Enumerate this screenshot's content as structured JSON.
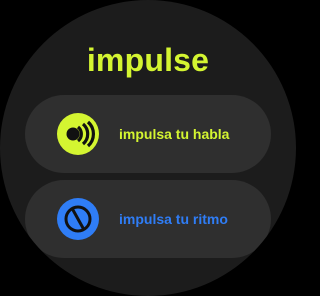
{
  "app": {
    "title": "impulse"
  },
  "colors": {
    "background": "#1c1c1c",
    "chip": "#2f2f2f",
    "accent_speech": "#d4f531",
    "accent_rhythm": "#2f7df6"
  },
  "chips": [
    {
      "label": "impulsa tu habla",
      "icon": "speech-waves-icon"
    },
    {
      "label": "impulsa tu ritmo",
      "icon": "metronome-icon"
    }
  ]
}
